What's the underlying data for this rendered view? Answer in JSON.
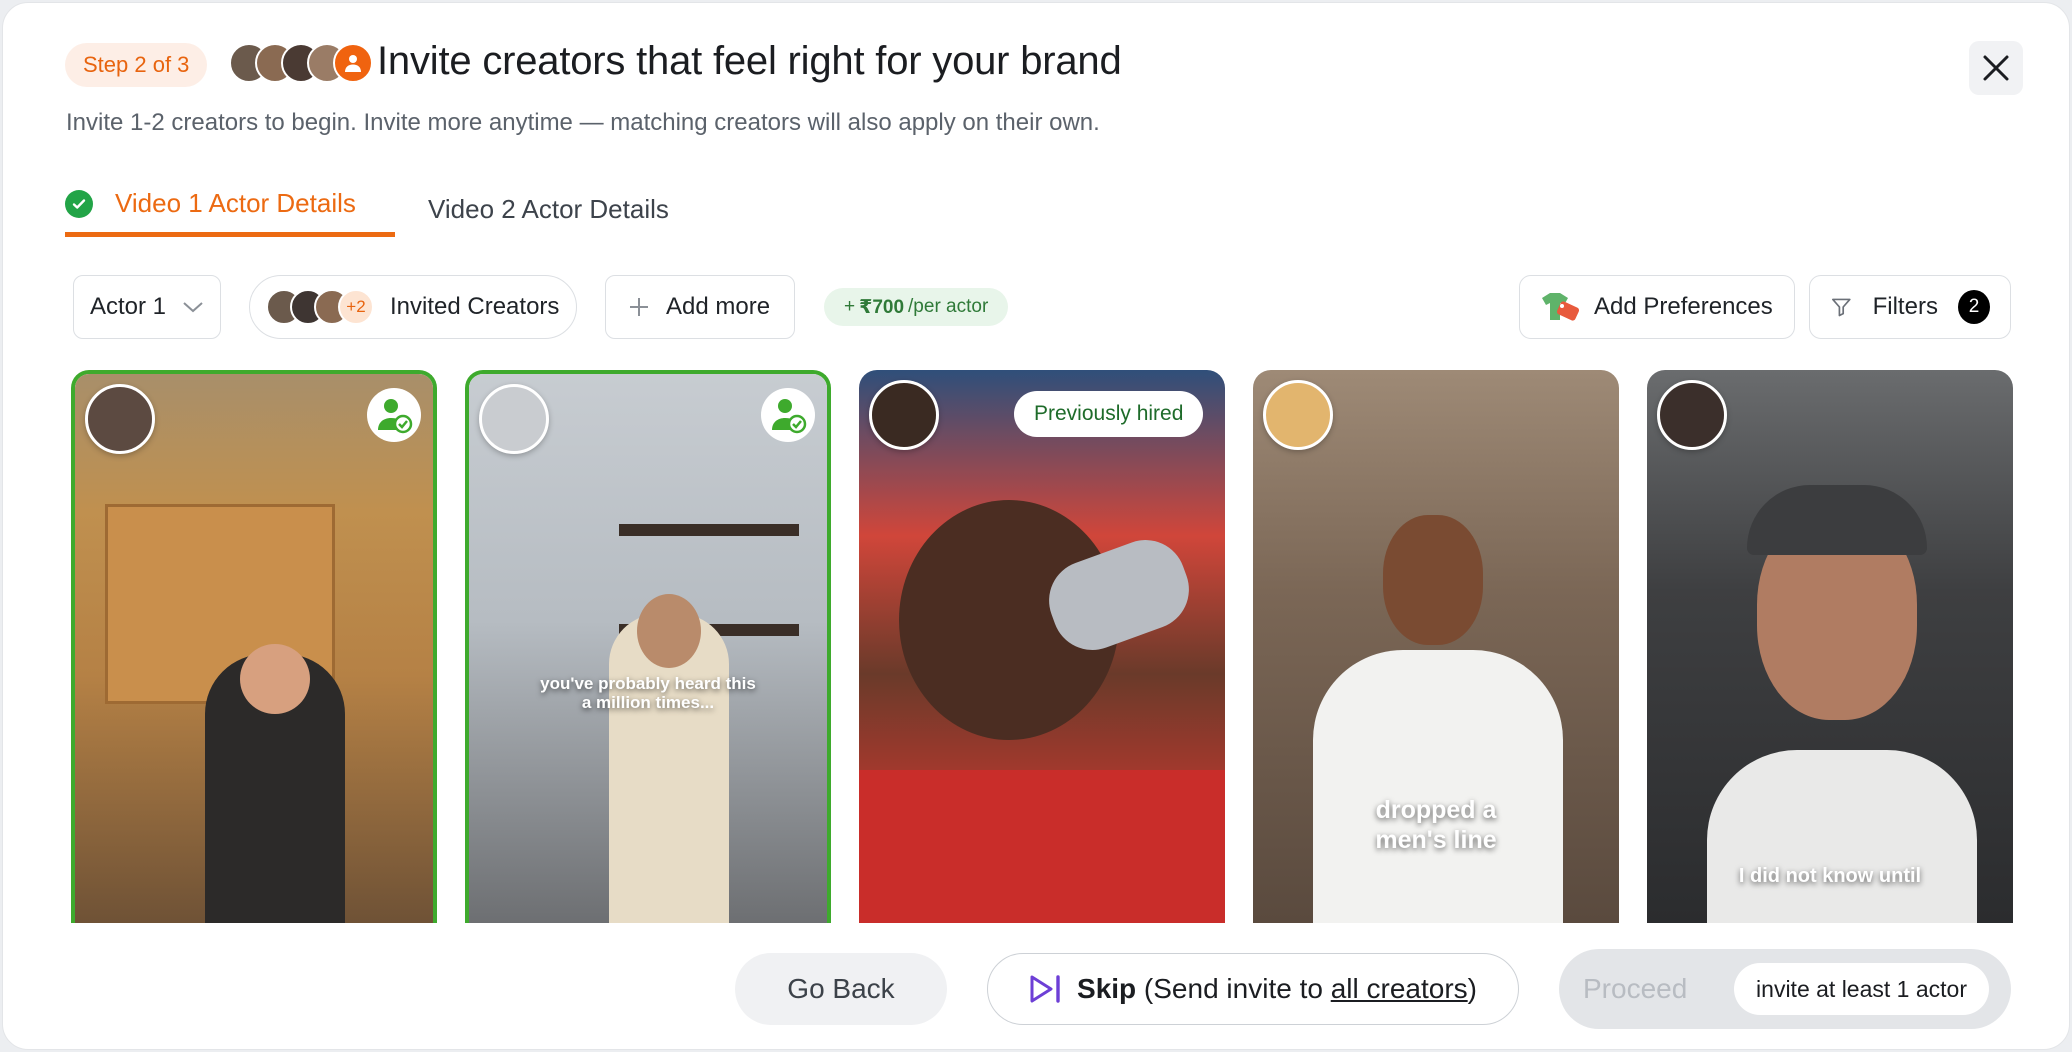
{
  "header": {
    "step": "Step 2 of 3",
    "title": "Invite creators that feel right for your brand",
    "subtitle": "Invite 1-2 creators to begin. Invite more anytime — matching creators will also apply on their own."
  },
  "tabs": [
    {
      "label": "Video 1 Actor Details",
      "active": true,
      "completed": true
    },
    {
      "label": "Video 2 Actor Details",
      "active": false
    }
  ],
  "toolbar": {
    "actor_select": "Actor 1",
    "invited_label": "Invited Creators",
    "invited_extra": "+2",
    "add_more": "Add more",
    "price_prefix": "+ ",
    "price_amount": "₹700",
    "price_suffix": "/per actor",
    "add_preferences": "Add Preferences",
    "filters": "Filters",
    "filters_count": "2"
  },
  "cards": [
    {
      "selected": true,
      "invited": true,
      "caption": ""
    },
    {
      "selected": true,
      "invited": true,
      "caption": "you've probably heard this a million times..."
    },
    {
      "selected": false,
      "badge": "Previously hired",
      "caption": ""
    },
    {
      "selected": false,
      "caption": "dropped a men's line"
    },
    {
      "selected": false,
      "caption": "I did not know until"
    }
  ],
  "footer": {
    "go_back": "Go Back",
    "skip_bold": "Skip",
    "skip_open": " (Send invite to ",
    "skip_link": "all creators",
    "skip_close": ")",
    "proceed": "Proceed",
    "proceed_hint": "invite at least 1 actor"
  },
  "colors": {
    "accent": "#ec6a12",
    "selected_border": "#3eaa2d",
    "price_bg": "#e8f5ea",
    "skip_icon": "#6d3fd6"
  }
}
